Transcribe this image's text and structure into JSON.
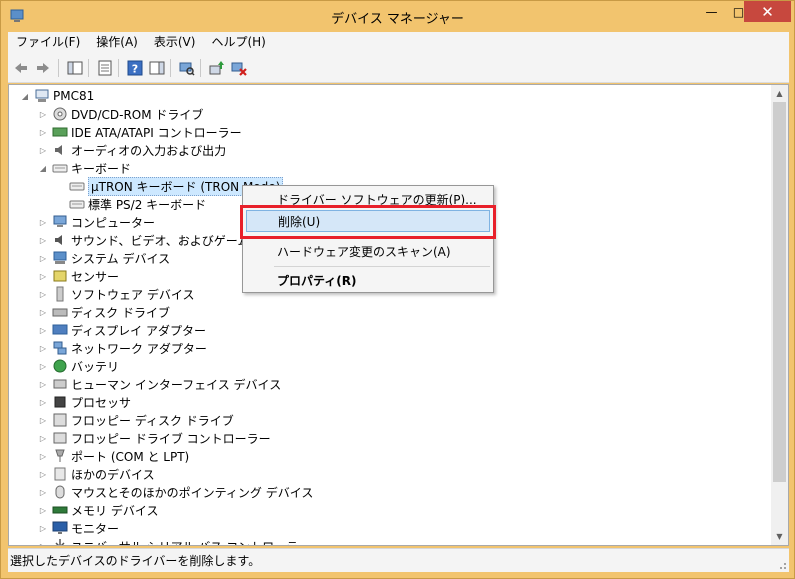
{
  "window": {
    "title": "デバイス マネージャー",
    "minimize": "—",
    "maximize": "□",
    "close": "✕"
  },
  "menubar": {
    "file": "ファイル(F)",
    "action": "操作(A)",
    "view": "表示(V)",
    "help": "ヘルプ(H)"
  },
  "tree": {
    "root": "PMC81",
    "items": [
      {
        "label": "DVD/CD-ROM ドライブ",
        "icon": "dvd-icon"
      },
      {
        "label": "IDE ATA/ATAPI コントローラー",
        "icon": "ide-icon"
      },
      {
        "label": "オーディオの入力および出力",
        "icon": "audio-icon"
      },
      {
        "label": "キーボード",
        "icon": "keyboard-icon"
      },
      {
        "label": "μTRON キーボード (TRON Mode)",
        "icon": "keyboard-icon"
      },
      {
        "label": "標準 PS/2 キーボード",
        "icon": "keyboard-icon"
      },
      {
        "label": "コンピューター",
        "icon": "computer-icon"
      },
      {
        "label": "サウンド、ビデオ、およびゲーム コントローラー",
        "icon": "sound-icon"
      },
      {
        "label": "システム デバイス",
        "icon": "system-icon"
      },
      {
        "label": "センサー",
        "icon": "sensor-icon"
      },
      {
        "label": "ソフトウェア デバイス",
        "icon": "software-icon"
      },
      {
        "label": "ディスク ドライブ",
        "icon": "disk-icon"
      },
      {
        "label": "ディスプレイ アダプター",
        "icon": "display-icon"
      },
      {
        "label": "ネットワーク アダプター",
        "icon": "network-icon"
      },
      {
        "label": "バッテリ",
        "icon": "battery-icon"
      },
      {
        "label": "ヒューマン インターフェイス デバイス",
        "icon": "hid-icon"
      },
      {
        "label": "プロセッサ",
        "icon": "processor-icon"
      },
      {
        "label": "フロッピー ディスク ドライブ",
        "icon": "floppy-icon"
      },
      {
        "label": "フロッピー ドライブ コントローラー",
        "icon": "floppy-controller-icon"
      },
      {
        "label": "ポート (COM と LPT)",
        "icon": "port-icon"
      },
      {
        "label": "ほかのデバイス",
        "icon": "other-device-icon"
      },
      {
        "label": "マウスとそのほかのポインティング デバイス",
        "icon": "mouse-icon"
      },
      {
        "label": "メモリ デバイス",
        "icon": "memory-icon"
      },
      {
        "label": "モニター",
        "icon": "monitor-icon"
      },
      {
        "label": "ユニバーサル シリアル バス コントローラー",
        "icon": "usb-icon"
      }
    ]
  },
  "context_menu": {
    "update_driver": "ドライバー ソフトウェアの更新(P)...",
    "uninstall": "削除(U)",
    "scan": "ハードウェア変更のスキャン(A)",
    "properties": "プロパティ(R)"
  },
  "statusbar": {
    "text": "選択したデバイスのドライバーを削除します。"
  },
  "colors": {
    "frame": "#f2c46e",
    "close_button": "#c7483e",
    "highlight": "#e8202a",
    "selection": "#cde8ff"
  }
}
